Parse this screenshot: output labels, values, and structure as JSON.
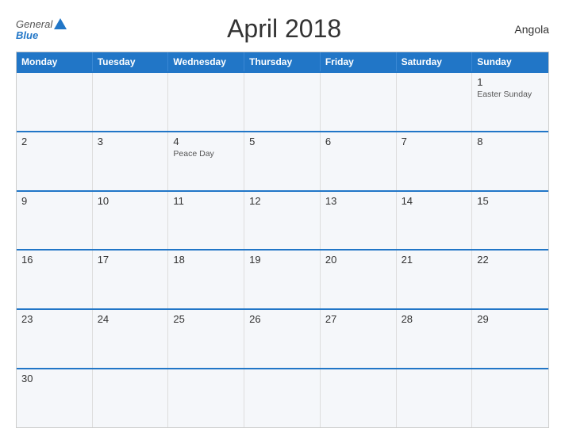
{
  "header": {
    "logo_general": "General",
    "logo_blue": "Blue",
    "title": "April 2018",
    "country": "Angola"
  },
  "calendar": {
    "days_of_week": [
      "Monday",
      "Tuesday",
      "Wednesday",
      "Thursday",
      "Friday",
      "Saturday",
      "Sunday"
    ],
    "rows": [
      [
        {
          "day": "",
          "event": ""
        },
        {
          "day": "",
          "event": ""
        },
        {
          "day": "",
          "event": ""
        },
        {
          "day": "",
          "event": ""
        },
        {
          "day": "",
          "event": ""
        },
        {
          "day": "",
          "event": ""
        },
        {
          "day": "1",
          "event": "Easter Sunday"
        }
      ],
      [
        {
          "day": "2",
          "event": ""
        },
        {
          "day": "3",
          "event": ""
        },
        {
          "day": "4",
          "event": "Peace Day"
        },
        {
          "day": "5",
          "event": ""
        },
        {
          "day": "6",
          "event": ""
        },
        {
          "day": "7",
          "event": ""
        },
        {
          "day": "8",
          "event": ""
        }
      ],
      [
        {
          "day": "9",
          "event": ""
        },
        {
          "day": "10",
          "event": ""
        },
        {
          "day": "11",
          "event": ""
        },
        {
          "day": "12",
          "event": ""
        },
        {
          "day": "13",
          "event": ""
        },
        {
          "day": "14",
          "event": ""
        },
        {
          "day": "15",
          "event": ""
        }
      ],
      [
        {
          "day": "16",
          "event": ""
        },
        {
          "day": "17",
          "event": ""
        },
        {
          "day": "18",
          "event": ""
        },
        {
          "day": "19",
          "event": ""
        },
        {
          "day": "20",
          "event": ""
        },
        {
          "day": "21",
          "event": ""
        },
        {
          "day": "22",
          "event": ""
        }
      ],
      [
        {
          "day": "23",
          "event": ""
        },
        {
          "day": "24",
          "event": ""
        },
        {
          "day": "25",
          "event": ""
        },
        {
          "day": "26",
          "event": ""
        },
        {
          "day": "27",
          "event": ""
        },
        {
          "day": "28",
          "event": ""
        },
        {
          "day": "29",
          "event": ""
        }
      ],
      [
        {
          "day": "30",
          "event": ""
        },
        {
          "day": "",
          "event": ""
        },
        {
          "day": "",
          "event": ""
        },
        {
          "day": "",
          "event": ""
        },
        {
          "day": "",
          "event": ""
        },
        {
          "day": "",
          "event": ""
        },
        {
          "day": "",
          "event": ""
        }
      ]
    ]
  }
}
